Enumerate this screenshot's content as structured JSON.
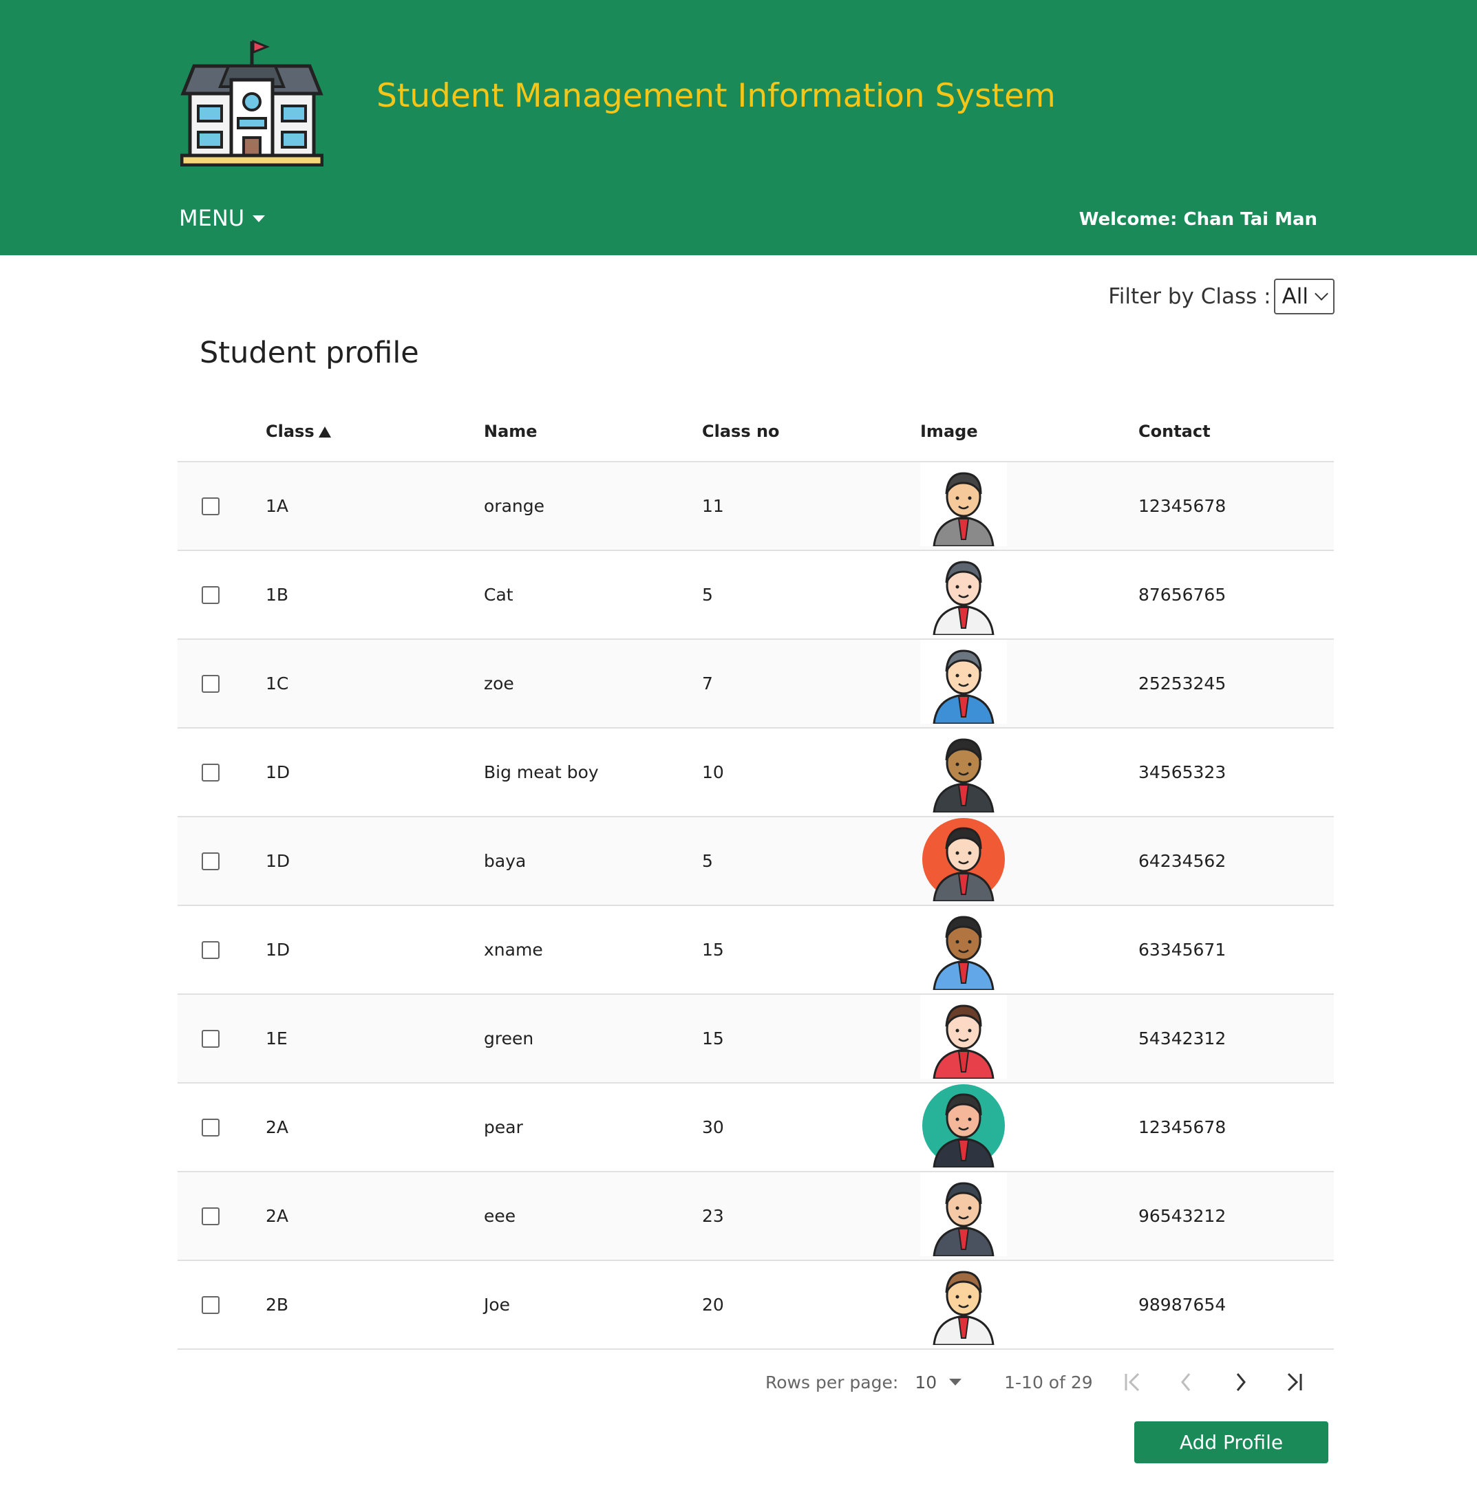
{
  "header": {
    "app_title": "Student Management Information System",
    "menu_label": "MENU",
    "welcome_text": "Welcome: Chan Tai Man",
    "logo_icon": "school-building-icon"
  },
  "filter": {
    "label": "Filter by Class :",
    "selected": "All"
  },
  "page_title": "Student profile",
  "table": {
    "columns": [
      "Class",
      "Name",
      "Class no",
      "Image",
      "Contact"
    ],
    "sorted_column": "Class",
    "sort_direction": "ascending",
    "rows": [
      {
        "class": "1A",
        "name": "orange",
        "class_no": "11",
        "image": "graduate-muscles-avatar",
        "contact": "12345678"
      },
      {
        "class": "1B",
        "name": "Cat",
        "class_no": "5",
        "image": "girl-studying-avatar",
        "contact": "87656765"
      },
      {
        "class": "1C",
        "name": "zoe",
        "class_no": "7",
        "image": "kid-reading-avatar",
        "contact": "25253245"
      },
      {
        "class": "1D",
        "name": "Big meat boy",
        "class_no": "10",
        "image": "man-suit-avatar",
        "contact": "34565323"
      },
      {
        "class": "1D",
        "name": "baya",
        "class_no": "5",
        "image": "businessman-red-circle-avatar",
        "contact": "64234562"
      },
      {
        "class": "1D",
        "name": "xname",
        "class_no": "15",
        "image": "boy-blue-shirt-avatar",
        "contact": "63345671"
      },
      {
        "class": "1E",
        "name": "green",
        "class_no": "15",
        "image": "girl-idea-book-avatar",
        "contact": "54342312"
      },
      {
        "class": "2A",
        "name": "pear",
        "class_no": "30",
        "image": "man-teal-circle-avatar",
        "contact": "12345678"
      },
      {
        "class": "2A",
        "name": "eee",
        "class_no": "23",
        "image": "man-laptop-avatar",
        "contact": "96543212"
      },
      {
        "class": "2B",
        "name": "Joe",
        "class_no": "20",
        "image": "boy-book-sparkles-avatar",
        "contact": "98987654"
      }
    ]
  },
  "pagination": {
    "rows_per_page_label": "Rows per page:",
    "rows_per_page": "10",
    "range_text": "1-10 of 29"
  },
  "actions": {
    "add_profile_label": "Add Profile"
  },
  "colors": {
    "brand_green": "#1a8a59",
    "title_yellow": "#f5c518"
  }
}
